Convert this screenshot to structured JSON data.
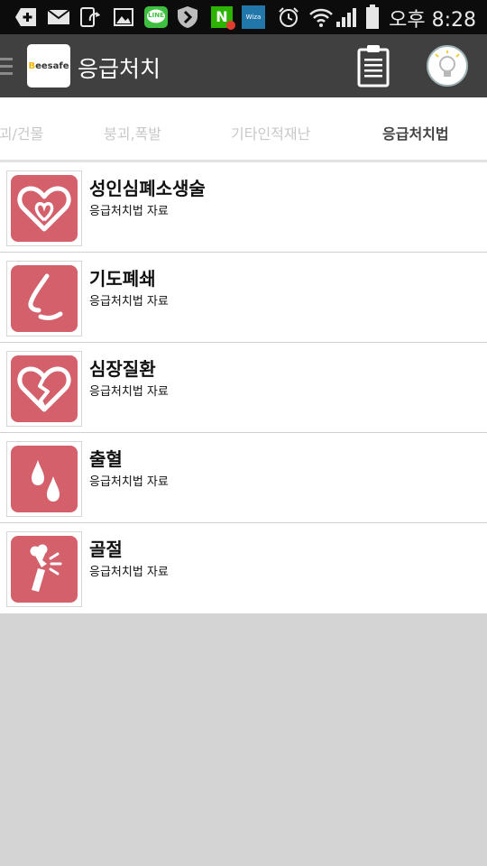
{
  "status_bar": {
    "icons": [
      "add-icon",
      "mail-icon",
      "sync-icon",
      "image-icon",
      "line-icon",
      "shield-icon",
      "naver-icon",
      "wiza-icon",
      "alarm-icon",
      "wifi-icon",
      "signal-icon",
      "battery-icon"
    ],
    "line_label": "LINE",
    "naver_label": "N",
    "wiza_label": "Wiza",
    "time": "오후 8:28"
  },
  "app_bar": {
    "logo_text_b": "B",
    "logo_text": "eesafe",
    "title": "응급처치",
    "accent": "#404040"
  },
  "tabs": [
    {
      "label": "붕괴/건물"
    },
    {
      "label": "붕괴,폭발"
    },
    {
      "label": "기타인적재난"
    },
    {
      "label": "응급처치법",
      "active": true
    }
  ],
  "list": {
    "items": [
      {
        "title": "성인심폐소생술",
        "subtitle": "응급처치법 자료",
        "icon": "heart-icon"
      },
      {
        "title": "기도폐쇄",
        "subtitle": "응급처치법 자료",
        "icon": "nose-icon"
      },
      {
        "title": "심장질환",
        "subtitle": "응급처치법 자료",
        "icon": "broken-heart-icon"
      },
      {
        "title": "출혈",
        "subtitle": "응급처치법 자료",
        "icon": "blood-drops-icon"
      },
      {
        "title": "골절",
        "subtitle": "응급처치법 자료",
        "icon": "fracture-icon"
      }
    ],
    "tile_color": "#d4606c"
  }
}
